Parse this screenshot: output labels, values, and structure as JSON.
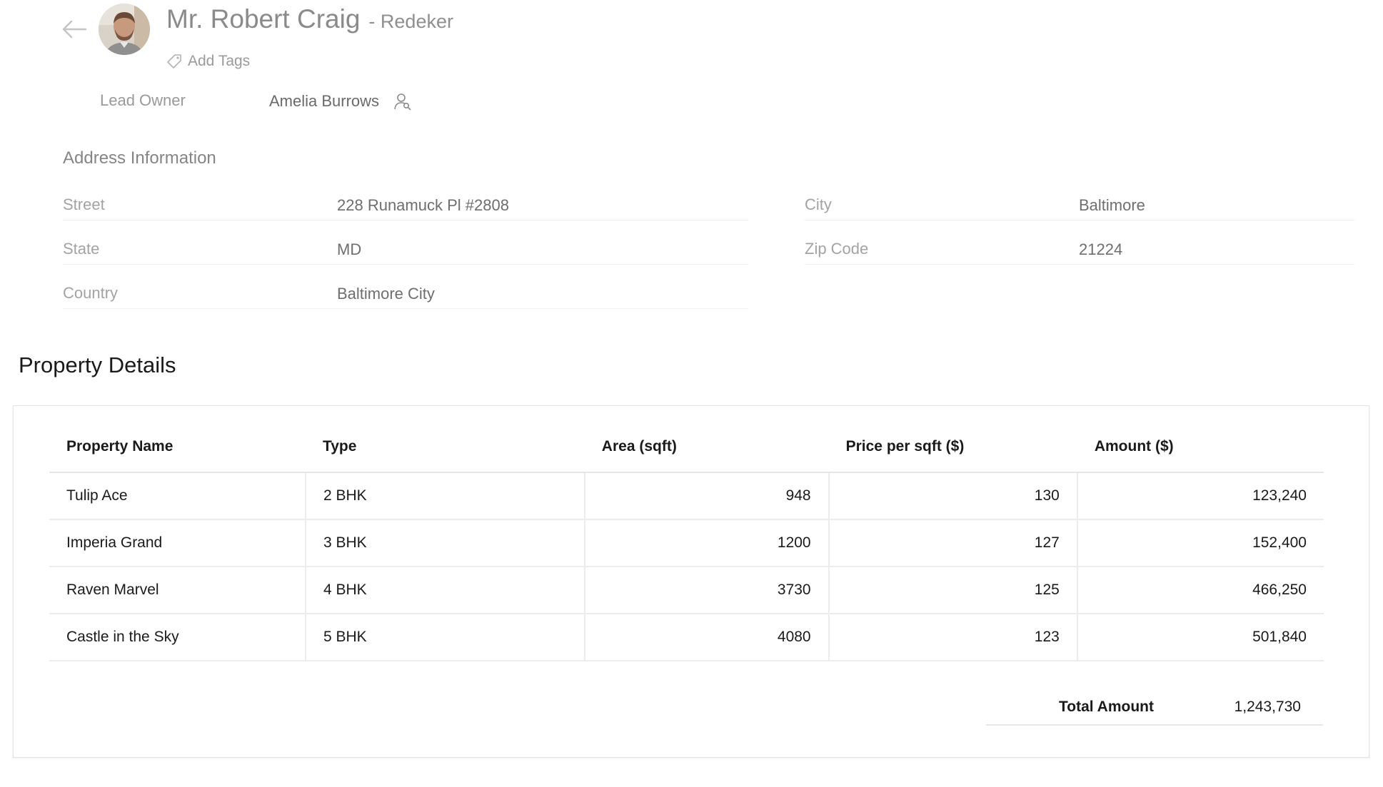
{
  "header": {
    "name": "Mr. Robert Craig",
    "company_suffix": "- Redeker",
    "add_tags_label": "Add Tags",
    "lead_owner_label": "Lead Owner",
    "lead_owner_value": "Amelia Burrows"
  },
  "address": {
    "title": "Address Information",
    "fields": {
      "street": {
        "label": "Street",
        "value": "228 Runamuck Pl #2808"
      },
      "city": {
        "label": "City",
        "value": "Baltimore"
      },
      "state": {
        "label": "State",
        "value": "MD"
      },
      "zip": {
        "label": "Zip Code",
        "value": "21224"
      },
      "country": {
        "label": "Country",
        "value": "Baltimore City"
      }
    }
  },
  "property": {
    "title": "Property Details",
    "columns": [
      "Property Name",
      "Type",
      "Area (sqft)",
      "Price per sqft ($)",
      "Amount ($)"
    ],
    "rows": [
      [
        "Tulip Ace",
        "2 BHK",
        "948",
        "130",
        "123,240"
      ],
      [
        "Imperia Grand",
        "3 BHK",
        "1200",
        "127",
        "152,400"
      ],
      [
        "Raven Marvel",
        "4 BHK",
        "3730",
        "125",
        "466,250"
      ],
      [
        "Castle in the Sky",
        "5 BHK",
        "4080",
        "123",
        "501,840"
      ]
    ],
    "total_label": "Total Amount",
    "total_value": "1,243,730"
  },
  "icons": {
    "back": "back-arrow-icon",
    "tag": "tag-icon",
    "owner": "user-search-icon"
  }
}
